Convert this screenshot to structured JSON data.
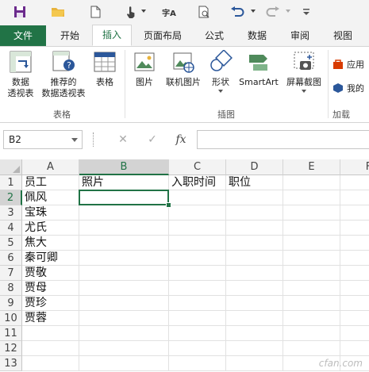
{
  "colors": {
    "accent": "#217346",
    "qat_bg": "#f3f3f3",
    "header_bg": "#f3f3f3"
  },
  "qat": {
    "icons": [
      "save-icon",
      "open-folder-icon",
      "new-document-icon",
      "touch-mode-icon",
      "translate-icon",
      "print-preview-icon",
      "undo-icon",
      "redo-icon",
      "customize-qat-icon"
    ],
    "translate_glyph": "字A"
  },
  "tabs": [
    {
      "label": "文件"
    },
    {
      "label": "开始"
    },
    {
      "label": "插入"
    },
    {
      "label": "页面布局"
    },
    {
      "label": "公式"
    },
    {
      "label": "数据"
    },
    {
      "label": "审阅"
    },
    {
      "label": "视图"
    }
  ],
  "ribbon": {
    "pivot_table": "数据\n透视表",
    "pivot_table_l1": "数据",
    "pivot_table_l2": "透视表",
    "recommended_l1": "推荐的",
    "recommended_l2": "数据透视表",
    "table": "表格",
    "group_tables": "表格",
    "pictures": "图片",
    "online_pictures": "联机图片",
    "shapes": "形状",
    "smartart": "SmartArt",
    "screenshot": "屏幕截图",
    "group_illustrations": "插图",
    "apps_label": "应用",
    "my_apps_label": "我的",
    "group_addins": "加载"
  },
  "formula_bar": {
    "name_box": "B2",
    "fx_label": "fx",
    "cancel": "✕",
    "enter": "✓",
    "value": ""
  },
  "sheet": {
    "columns": [
      "A",
      "B",
      "C",
      "D",
      "E",
      "F"
    ],
    "selected_column": "B",
    "selected_row": 2,
    "rows": [
      {
        "n": "1",
        "cells": [
          "员工",
          "照片",
          "入职时间",
          "职位",
          "",
          ""
        ]
      },
      {
        "n": "2",
        "cells": [
          "佩风",
          "",
          "",
          "",
          "",
          ""
        ]
      },
      {
        "n": "3",
        "cells": [
          "宝珠",
          "",
          "",
          "",
          "",
          ""
        ]
      },
      {
        "n": "4",
        "cells": [
          "尤氏",
          "",
          "",
          "",
          "",
          ""
        ]
      },
      {
        "n": "5",
        "cells": [
          "焦大",
          "",
          "",
          "",
          "",
          ""
        ]
      },
      {
        "n": "6",
        "cells": [
          "秦可卿",
          "",
          "",
          "",
          "",
          ""
        ]
      },
      {
        "n": "7",
        "cells": [
          "贾敬",
          "",
          "",
          "",
          "",
          ""
        ]
      },
      {
        "n": "8",
        "cells": [
          "贾母",
          "",
          "",
          "",
          "",
          ""
        ]
      },
      {
        "n": "9",
        "cells": [
          "贾珍",
          "",
          "",
          "",
          "",
          ""
        ]
      },
      {
        "n": "10",
        "cells": [
          "贾蓉",
          "",
          "",
          "",
          "",
          ""
        ]
      },
      {
        "n": "11",
        "cells": [
          "",
          "",
          "",
          "",
          "",
          ""
        ]
      },
      {
        "n": "12",
        "cells": [
          "",
          "",
          "",
          "",
          "",
          ""
        ]
      },
      {
        "n": "13",
        "cells": [
          "",
          "",
          "",
          "",
          "",
          ""
        ]
      }
    ]
  },
  "watermark": "cfan.com"
}
